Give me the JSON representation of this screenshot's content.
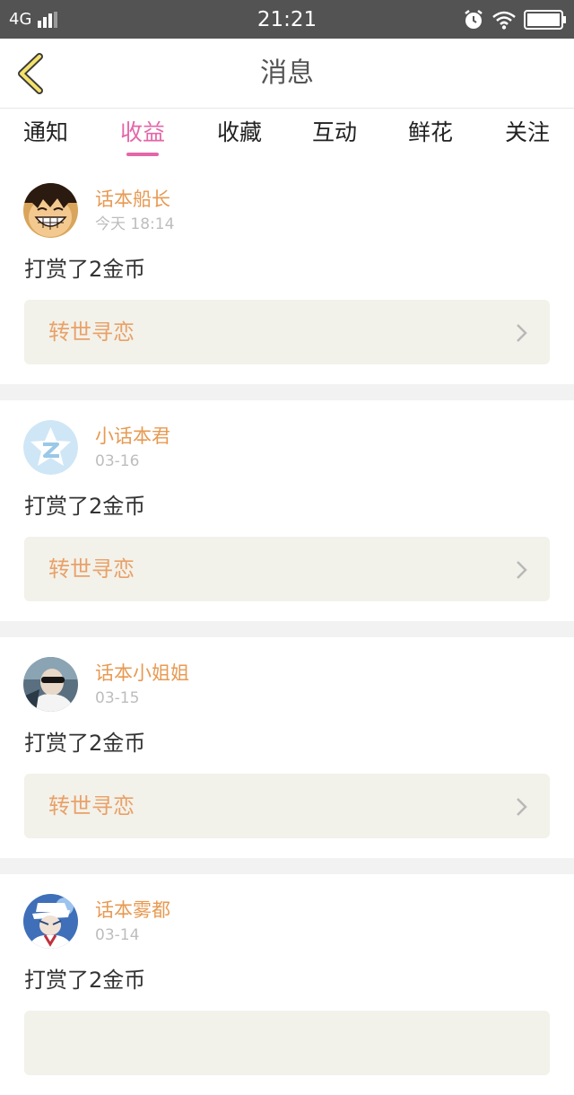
{
  "status_bar": {
    "network": "4G",
    "time": "21:21"
  },
  "header": {
    "title": "消息"
  },
  "tabs": [
    {
      "label": "通知",
      "active": false
    },
    {
      "label": "收益",
      "active": true
    },
    {
      "label": "收藏",
      "active": false
    },
    {
      "label": "互动",
      "active": false
    },
    {
      "label": "鲜花",
      "active": false
    },
    {
      "label": "关注",
      "active": false
    }
  ],
  "colors": {
    "accent": "#e466a8",
    "username": "#e79a52",
    "work_title": "#e9a169",
    "link_bg": "#f2f2ea"
  },
  "messages": [
    {
      "username": "话本船长",
      "time": "今天 18:14",
      "text": "打赏了2金币",
      "work": "转世寻恋",
      "avatar_icon": "luffy-avatar"
    },
    {
      "username": "小话本君",
      "time": "03-16",
      "text": "打赏了2金币",
      "work": "转世寻恋",
      "avatar_icon": "z-star-avatar"
    },
    {
      "username": "话本小姐姐",
      "time": "03-15",
      "text": "打赏了2金币",
      "work": "转世寻恋",
      "avatar_icon": "photo-avatar"
    },
    {
      "username": "话本雾都",
      "time": "03-14",
      "text": "打赏了2金币",
      "work": "",
      "avatar_icon": "anime-avatar"
    }
  ]
}
